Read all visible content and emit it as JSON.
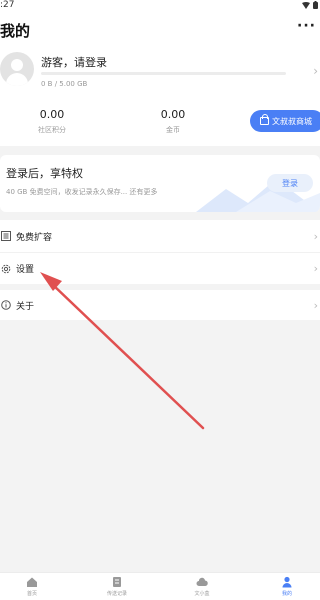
{
  "status_bar": {
    "time": ":27"
  },
  "header": {
    "title": "我的",
    "more_label": "···"
  },
  "profile": {
    "login_prompt": "游客，请登录",
    "quota": "0 B / 5.00 GB",
    "stats": [
      {
        "value": "0.00",
        "label": "社区积分"
      },
      {
        "value": "0.00",
        "label": "金币"
      }
    ],
    "mall_button": "文叔叔商城"
  },
  "promo": {
    "title": "登录后，享特权",
    "description": "40 GB 免费空间，收发记录永久保存... 还有更多",
    "login_button": "登录"
  },
  "menu": {
    "items": [
      {
        "label": "免费扩容",
        "icon": "list-icon"
      },
      {
        "label": "设置",
        "icon": "gear-icon"
      },
      {
        "label": "关于",
        "icon": "info-icon"
      }
    ]
  },
  "tabbar": {
    "tabs": [
      {
        "label": "首页",
        "icon": "home-icon"
      },
      {
        "label": "传送记录",
        "icon": "records-icon"
      },
      {
        "label": "文小盒",
        "icon": "cloud-icon"
      },
      {
        "label": "我的",
        "icon": "user-icon",
        "active": true
      }
    ]
  },
  "colors": {
    "accent": "#4a7ff5",
    "annotation_arrow": "#e05050"
  }
}
